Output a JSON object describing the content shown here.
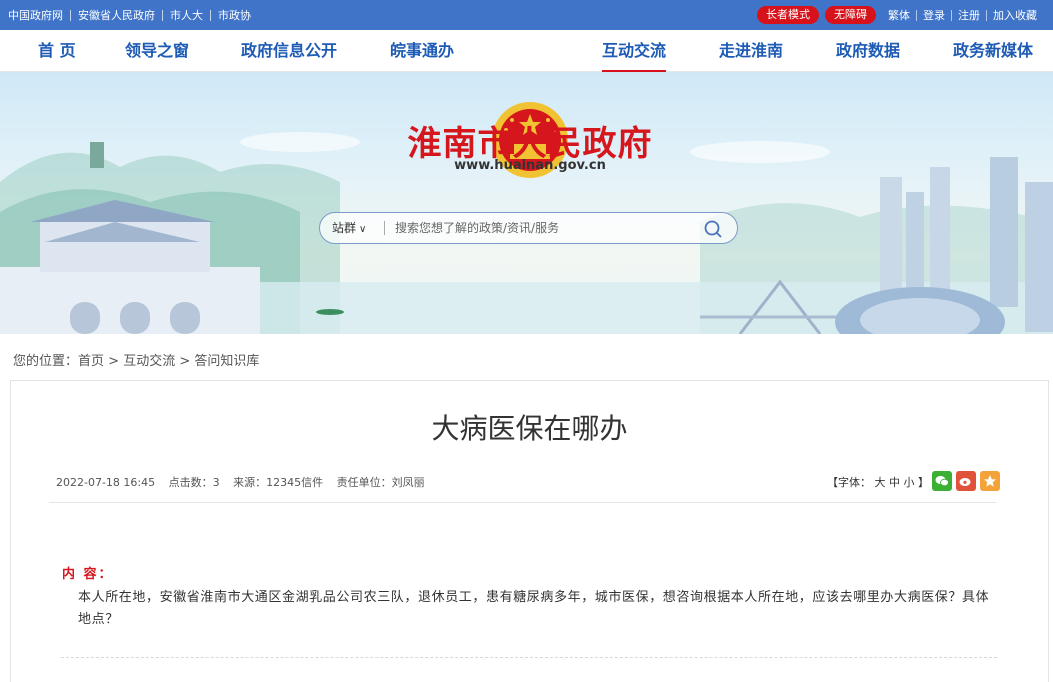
{
  "topbar": {
    "links": [
      "中国政府网",
      "安徽省人民政府",
      "市人大",
      "市政协"
    ],
    "elder_mode": "长者模式",
    "accessibility": "无障碍",
    "right_links": [
      "繁体",
      "登录",
      "注册",
      "加入收藏"
    ]
  },
  "nav": {
    "items": [
      "首 页",
      "领导之窗",
      "政府信息公开",
      "皖事通办",
      "互动交流",
      "走进淮南",
      "政府数据",
      "政务新媒体"
    ],
    "active": "互动交流"
  },
  "banner": {
    "site_title": "淮南市人民政府",
    "site_url": "www.huainan.gov.cn",
    "emblem_icon": "national-emblem-icon"
  },
  "search": {
    "scope": "站群",
    "placeholder": "搜索您想了解的政策/资讯/服务",
    "button_icon": "search-icon"
  },
  "breadcrumb": {
    "prefix": "您的位置：",
    "items": [
      "首页",
      "互动交流",
      "答问知识库"
    ],
    "separator": ">"
  },
  "article": {
    "title": "大病医保在哪办",
    "date": "2022-07-18 16:45",
    "clicks": "点击数：3",
    "source": "来源：12345信件",
    "unit": "责任单位：刘凤丽",
    "font_label": "【字体：",
    "font_sizes": [
      "大",
      "中",
      "小"
    ],
    "font_close": "】",
    "share_icons": [
      "wechat-icon",
      "weibo-icon",
      "favorite-icon"
    ],
    "content_label": "内 容：",
    "content_text": "本人所在地，安徽省淮南市大通区金湖乳品公司农三队，退休员工，患有糖尿病多年，城市医保，想咨询根据本人所在地，应该去哪里办大病医保？具体地点？"
  },
  "colors": {
    "topbar_bg": "#3f74c8",
    "nav_text": "#1d5bb5",
    "accent_red": "#d6161d",
    "wechat": "#3cb034",
    "weibo": "#e0533a",
    "favorite": "#f3a33a"
  }
}
